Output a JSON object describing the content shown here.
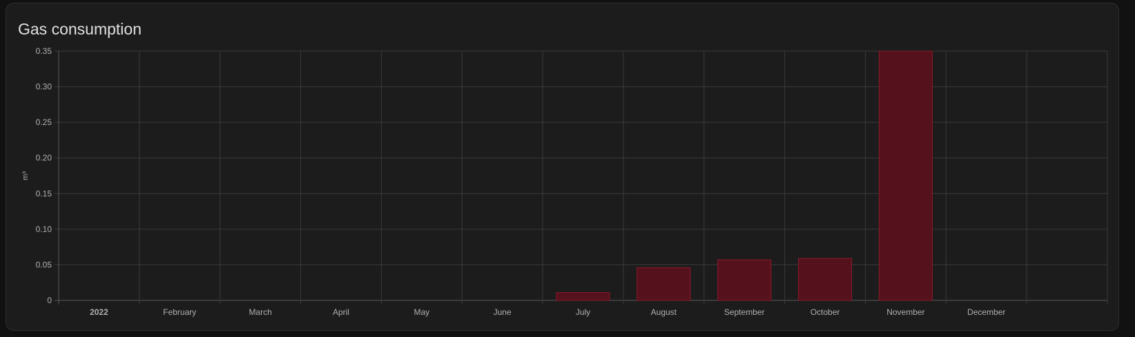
{
  "card": {
    "title": "Gas consumption"
  },
  "colors": {
    "page_background": "#111111",
    "card_background": "#1c1c1c",
    "grid": "#3a3a3a",
    "axis": "#5a5a5a",
    "bar_fill": "#55111c",
    "bar_stroke": "#8a1b2c",
    "text": "#b0b0b0",
    "title": "#e1e1e1"
  },
  "chart_data": {
    "type": "bar",
    "title": "Gas consumption",
    "xlabel": "",
    "ylabel": "m³",
    "ylim": [
      0,
      0.35
    ],
    "y_ticks": [
      "0",
      "0.05",
      "0.10",
      "0.15",
      "0.20",
      "0.25",
      "0.30",
      "0.35"
    ],
    "categories": [
      "2022",
      "February",
      "March",
      "April",
      "May",
      "June",
      "July",
      "August",
      "September",
      "October",
      "November",
      "December"
    ],
    "values": [
      0,
      0,
      0,
      0,
      0,
      0,
      0.011,
      0.046,
      0.057,
      0.059,
      0.35,
      0
    ],
    "grid": true,
    "legend": false
  }
}
